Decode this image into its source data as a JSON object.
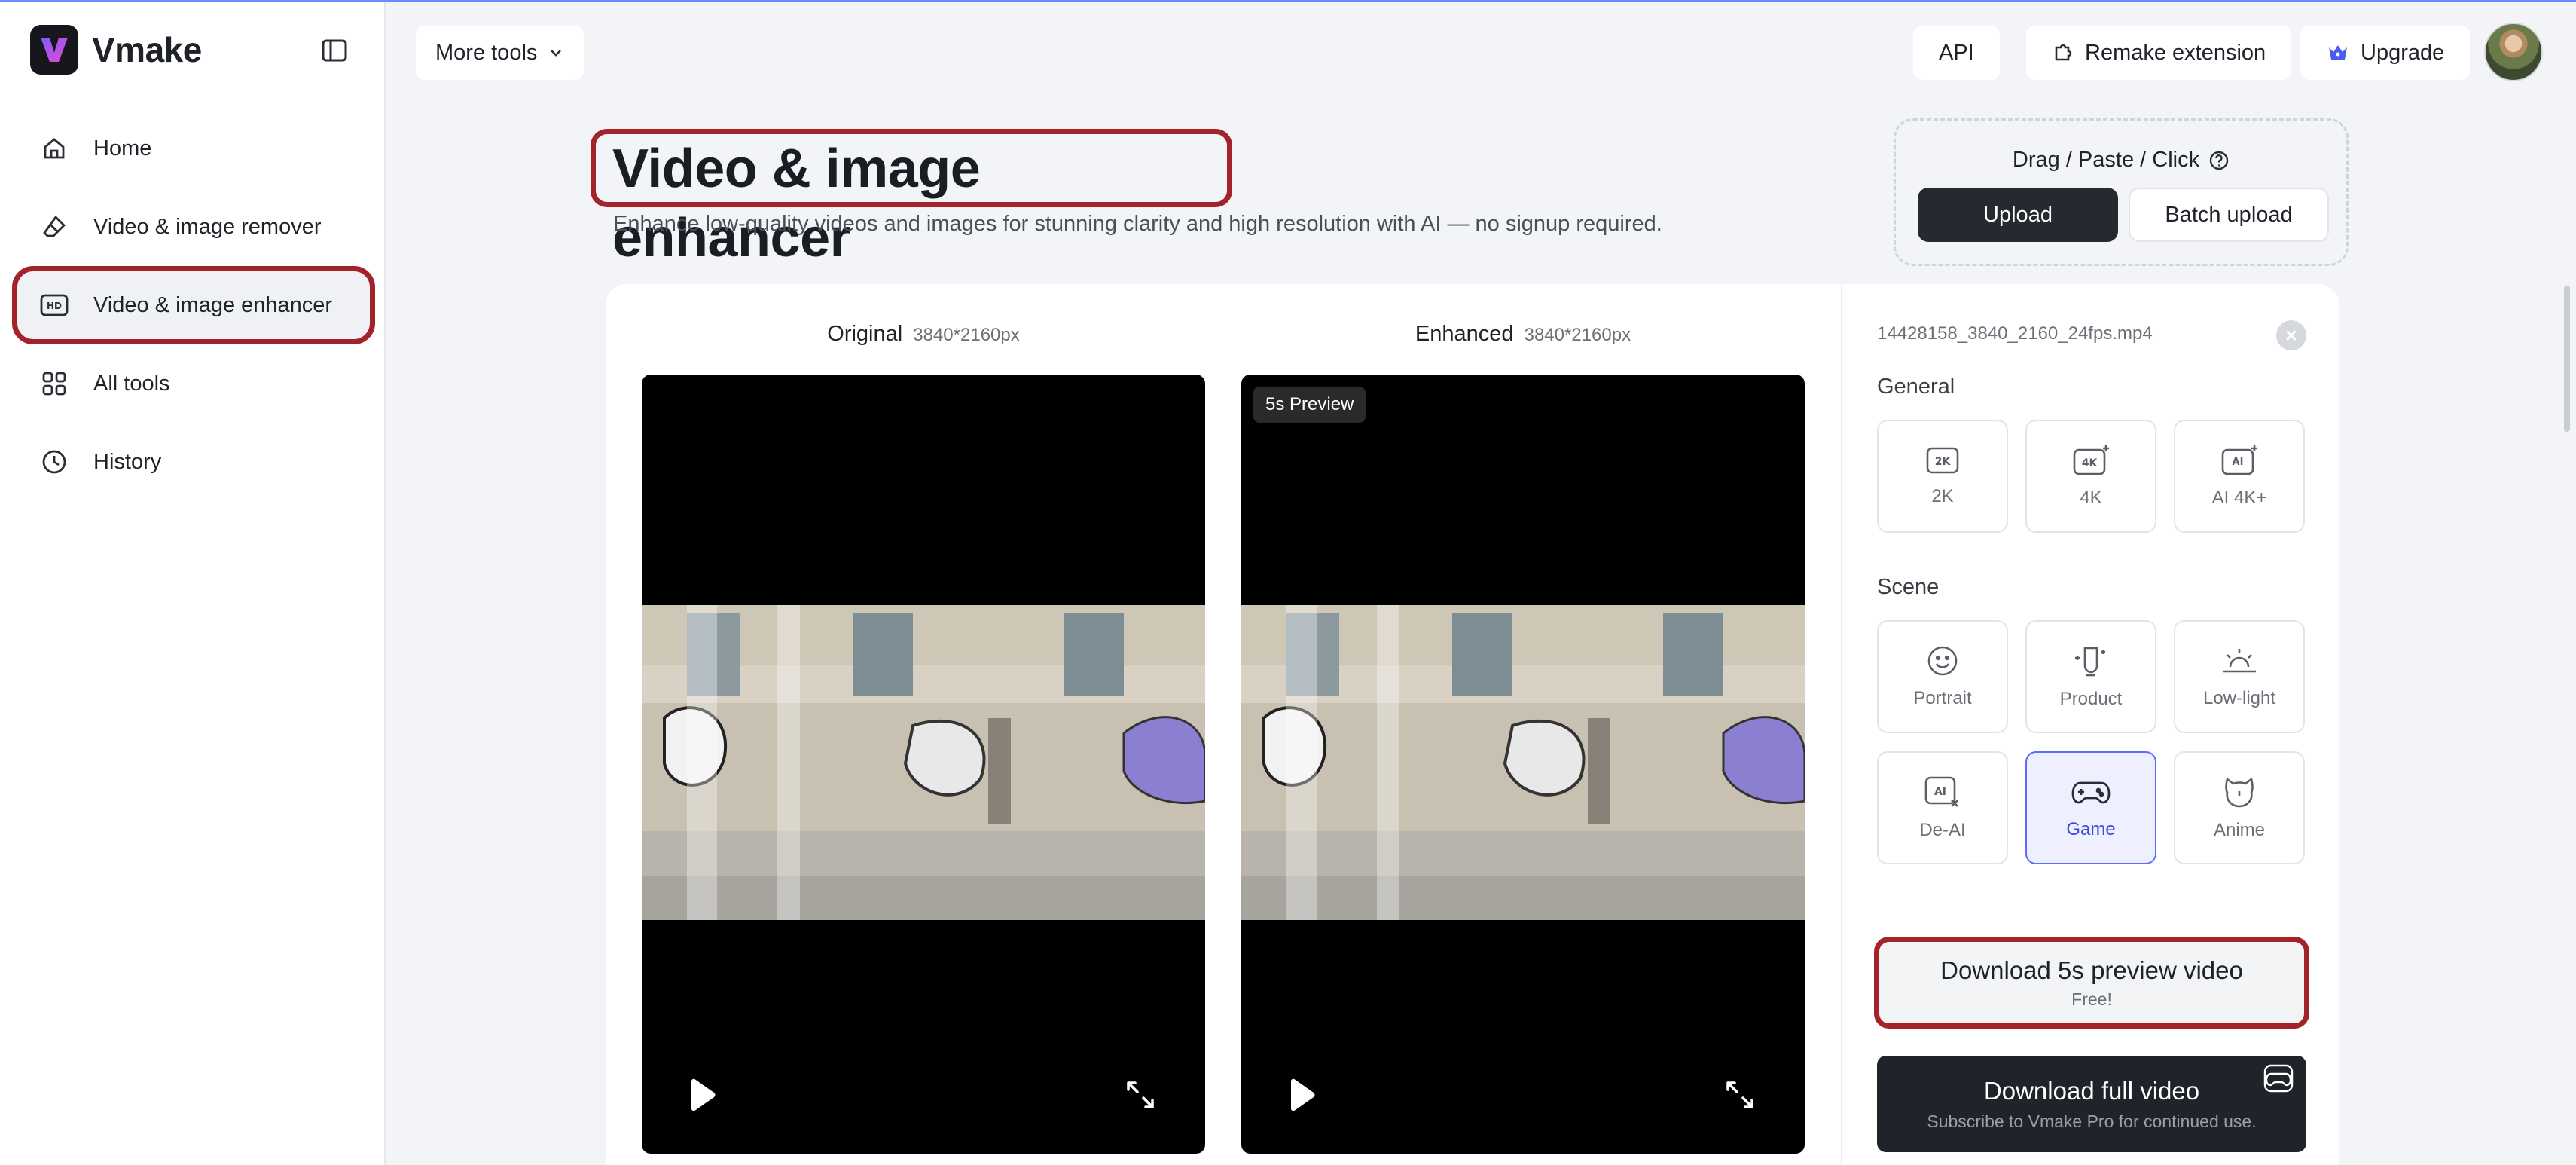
{
  "brand": {
    "name": "Vmake"
  },
  "sidebar": {
    "items": [
      {
        "label": "Home",
        "icon": "home-icon"
      },
      {
        "label": "Video & image remover",
        "icon": "eraser-icon"
      },
      {
        "label": "Video & image enhancer",
        "icon": "hd-icon",
        "active": true
      },
      {
        "label": "All tools",
        "icon": "grid-icon"
      },
      {
        "label": "History",
        "icon": "clock-icon"
      }
    ]
  },
  "topbar": {
    "more_tools": "More tools",
    "api": "API",
    "remake_extension": "Remake extension",
    "upgrade": "Upgrade"
  },
  "hero": {
    "title": "Video & image enhancer",
    "subtitle": "Enhance low-quality videos and images for stunning clarity and high resolution with AI — no signup required."
  },
  "upload": {
    "hint": "Drag / Paste / Click",
    "upload_label": "Upload",
    "batch_label": "Batch upload"
  },
  "preview": {
    "original_label": "Original",
    "original_dim": "3840*2160px",
    "enhanced_label": "Enhanced",
    "enhanced_dim": "3840*2160px",
    "badge": "5s Preview"
  },
  "settings": {
    "file_name": "14428158_3840_2160_24fps.mp4",
    "general_label": "General",
    "general_options": [
      "2K",
      "4K",
      "AI 4K+"
    ],
    "scene_label": "Scene",
    "scene_options": [
      "Portrait",
      "Product",
      "Low-light",
      "De-AI",
      "Game",
      "Anime"
    ],
    "selected_scene": "Game",
    "download_preview": {
      "label": "Download 5s preview video",
      "sub": "Free!"
    },
    "download_full": {
      "label": "Download full video",
      "sub": "Subscribe to Vmake Pro for continued use."
    }
  },
  "colors": {
    "highlight": "#a4232a",
    "accent": "#5b6cff",
    "dark_button": "#26292f"
  }
}
